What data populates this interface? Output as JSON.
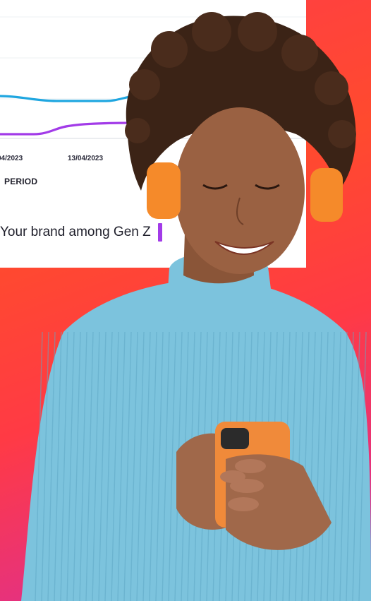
{
  "chart_data": {
    "type": "line",
    "x_tick_labels": [
      "04/2023",
      "13/04/2023"
    ],
    "xlabel": "PERIOD",
    "series": [
      {
        "color": "#1fa6e0"
      },
      {
        "color": "#a23be8"
      }
    ]
  },
  "legend": {
    "label": "Your brand among Gen Z",
    "swatch_color": "#a23be8"
  },
  "photo": {
    "subject": "person-with-headphones-and-phone",
    "sweater_color": "#7cc3dd",
    "headphones_color": "#f58a2a",
    "phone_color": "#f08a3a"
  },
  "background": {
    "colors": [
      "#ff3b4a",
      "#ff4a2e",
      "#e0308a",
      "#b02cc8"
    ]
  }
}
